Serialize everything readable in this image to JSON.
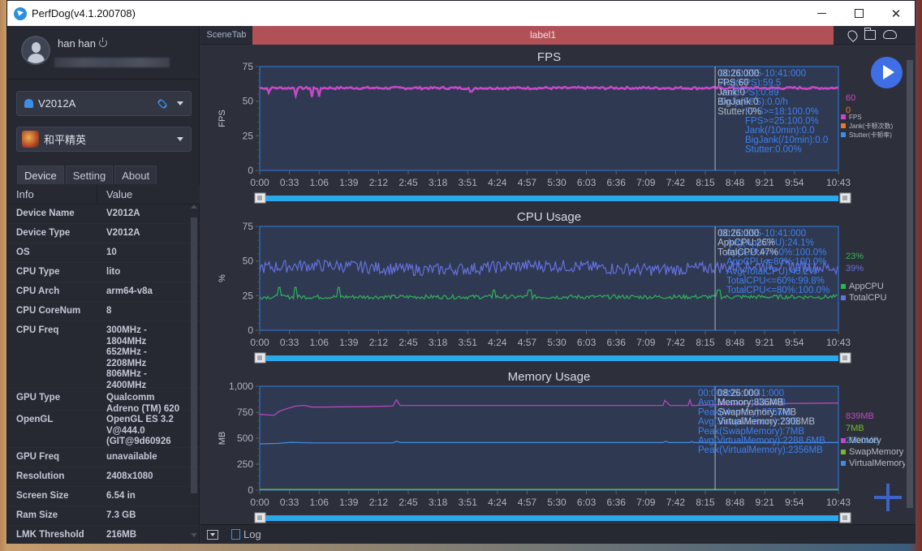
{
  "window": {
    "title": "PerfDog(v4.1.200708)"
  },
  "user": {
    "name": "han han"
  },
  "device_select": {
    "value": "V2012A"
  },
  "app_select": {
    "value": "和平精英"
  },
  "sidebar_tabs": [
    {
      "label": "Device",
      "active": true
    },
    {
      "label": "Setting",
      "active": false
    },
    {
      "label": "About",
      "active": false
    }
  ],
  "info_table": {
    "headers": [
      "Info",
      "Value"
    ],
    "rows": [
      {
        "key": "Device Name",
        "value": "V2012A"
      },
      {
        "key": "Device Type",
        "value": "V2012A"
      },
      {
        "key": "OS",
        "value": "10"
      },
      {
        "key": "CPU Type",
        "value": "lito"
      },
      {
        "key": "CPU Arch",
        "value": "arm64-v8a"
      },
      {
        "key": "CPU CoreNum",
        "value": "8"
      },
      {
        "key": "CPU Freq",
        "value": "300MHz -\n1804MHz\n652MHz -\n2208MHz\n806MHz -\n2400MHz"
      },
      {
        "key": "GPU Type",
        "value": "Qualcomm\nAdreno (TM) 620"
      },
      {
        "key": "OpenGL",
        "value": "OpenGL ES 3.2\nV@444.0\n(GIT@9d60926"
      },
      {
        "key": "GPU Freq",
        "value": "unavailable"
      },
      {
        "key": "Resolution",
        "value": "2408x1080"
      },
      {
        "key": "Screen Size",
        "value": "6.54 in"
      },
      {
        "key": "Ram Size",
        "value": "7.3 GB"
      },
      {
        "key": "LMK Threshold",
        "value": "216MB"
      }
    ]
  },
  "scene": {
    "tab_label": "SceneTab",
    "label": "label1"
  },
  "bottombar": {
    "log_label": "Log"
  },
  "colors": {
    "fps": "#c848c8",
    "jank": "#e8782a",
    "stutter": "#3e8ee8",
    "app_cpu": "#2fb35a",
    "total_cpu": "#6670e0",
    "memory": "#c048c0",
    "swap_memory": "#7ab82a",
    "virtual_memory": "#3e8ee8",
    "scene_label_bg": "#b25058",
    "play_button": "#3e6fe6"
  },
  "chart_data": [
    {
      "type": "line",
      "title": "FPS",
      "ylabel": "FPS",
      "ylim": [
        0,
        75
      ],
      "yticks": [
        "0",
        "25",
        "50",
        "75"
      ],
      "xticks": [
        "0:00",
        "0:33",
        "1:06",
        "1:39",
        "2:12",
        "2:45",
        "3:18",
        "3:51",
        "4:24",
        "4:57",
        "5:30",
        "6:03",
        "6:36",
        "7:09",
        "7:42",
        "8:15",
        "8:48",
        "9:21",
        "9:54",
        "10:43"
      ],
      "xlim_seconds": [
        0,
        643
      ],
      "cursor_time": "8:26",
      "series": [
        {
          "name": "FPS",
          "color": "#c848c8",
          "current": "60",
          "baseline": 59.5,
          "dips": [
            [
              10,
              56
            ],
            [
              40,
              54
            ],
            [
              58,
              53
            ],
            [
              66,
              54
            ],
            [
              235,
              57
            ]
          ]
        }
      ],
      "legend": [
        "FPS",
        "Jank(卡顿次数)",
        "Stutter(卡顿率)"
      ],
      "legend_values": [
        {
          "text": "60",
          "color": "#c848c8"
        },
        {
          "text": "0",
          "color": "#e8782a"
        }
      ],
      "cursor_tooltip": [
        "08:26:000",
        "FPS:60",
        "Jank:0",
        "BigJank:0",
        "Stutter:0%"
      ],
      "range_stats": [
        "00:00:895-10:41:000",
        "Avg(FPS):59.5",
        "Var(FPS):0.89",
        "Drop(FPS):0.0/h",
        "FPS>=18:100.0%",
        "FPS>=25:100.0%",
        "Jank(/10min):0.0",
        "BigJank(/10min):0.0",
        "Stutter:0.00%"
      ]
    },
    {
      "type": "line",
      "title": "CPU Usage",
      "ylabel": "%",
      "ylim": [
        0,
        75
      ],
      "yticks": [
        "0",
        "25",
        "50",
        "75"
      ],
      "xticks": [
        "0:00",
        "0:33",
        "1:06",
        "1:39",
        "2:12",
        "2:45",
        "3:18",
        "3:51",
        "4:24",
        "4:57",
        "5:30",
        "6:03",
        "6:36",
        "7:09",
        "7:42",
        "8:15",
        "8:48",
        "9:21",
        "9:54",
        "10:43"
      ],
      "xlim_seconds": [
        0,
        643
      ],
      "cursor_time": "8:26",
      "series": [
        {
          "name": "AppCPU",
          "color": "#2fb35a",
          "current": "23%",
          "baseline": 24.1,
          "spikes": [
            [
              22,
              31
            ],
            [
              40,
              31
            ],
            [
              88,
              31
            ],
            [
              260,
              29
            ],
            [
              300,
              29
            ],
            [
              510,
              29
            ]
          ]
        },
        {
          "name": "TotalCPU",
          "color": "#6670e0",
          "current": "39%",
          "baseline": 45.2
        }
      ],
      "legend": [
        "AppCPU",
        "TotalCPU"
      ],
      "cursor_tooltip": [
        "08:26:000",
        "AppCPU:26%",
        "TotalCPU:47%"
      ],
      "range_stats": [
        "00:00:895-10:41:000",
        "Avg(AppCPU):24.1%",
        "AppCPU<=60%:100.0%",
        "AppCPU<=80%:100.0%",
        "Avg(TotalCPU):45.2%",
        "TotalCPU<=60%:99.8%",
        "TotalCPU<=80%:100.0%"
      ]
    },
    {
      "type": "line",
      "title": "Memory Usage",
      "ylabel": "MB",
      "ylim": [
        0,
        1000
      ],
      "yticks": [
        "0",
        "250",
        "500",
        "750",
        "1,000"
      ],
      "xticks": [
        "0:00",
        "0:33",
        "1:06",
        "1:39",
        "2:12",
        "2:45",
        "3:18",
        "3:51",
        "4:24",
        "4:57",
        "5:30",
        "6:03",
        "6:36",
        "7:09",
        "7:42",
        "8:15",
        "8:48",
        "9:21",
        "9:54",
        "10:43"
      ],
      "xlim_seconds": [
        0,
        643
      ],
      "cursor_time": "8:26",
      "series": [
        {
          "name": "Memory",
          "color": "#c048c0",
          "current": "839MB",
          "points": [
            [
              0,
              730
            ],
            [
              8,
              725
            ],
            [
              16,
              720
            ],
            [
              22,
              760
            ],
            [
              32,
              790
            ],
            [
              40,
              810
            ],
            [
              50,
              815
            ],
            [
              58,
              800
            ],
            [
              70,
              800
            ],
            [
              120,
              805
            ],
            [
              148,
              810
            ],
            [
              152,
              870
            ],
            [
              156,
              815
            ],
            [
              300,
              815
            ],
            [
              420,
              815
            ],
            [
              448,
              815
            ],
            [
              450,
              865
            ],
            [
              456,
              815
            ],
            [
              476,
              815
            ],
            [
              478,
              870
            ],
            [
              480,
              815
            ],
            [
              530,
              830
            ],
            [
              600,
              835
            ],
            [
              643,
              839
            ]
          ]
        },
        {
          "name": "SwapMemory",
          "color": "#7ab82a",
          "current": "7MB",
          "points": [
            [
              0,
              7
            ],
            [
              643,
              7
            ]
          ]
        },
        {
          "name": "VirtualMemory",
          "color": "#3e8ee8",
          "current": "2300MB",
          "points": [
            [
              0,
              445
            ],
            [
              20,
              450
            ],
            [
              35,
              460
            ],
            [
              60,
              455
            ],
            [
              148,
              455
            ],
            [
              152,
              470
            ],
            [
              156,
              458
            ],
            [
              448,
              458
            ],
            [
              451,
              470
            ],
            [
              455,
              458
            ],
            [
              478,
              458
            ],
            [
              480,
              468
            ],
            [
              482,
              458
            ],
            [
              643,
              458
            ]
          ]
        }
      ],
      "legend": [
        "Memory",
        "SwapMemory",
        "VirtualMemory"
      ],
      "cursor_tooltip": [
        "08:26:000",
        "Memory:836MB",
        "SwapMemory:7MB",
        "VirtualMemory:2308MB"
      ],
      "range_stats": [
        "00:00:895-10:41:000",
        "Avg(Memory):813MB",
        "Peak(Memory):875MB",
        "Avg(SwapMemory):7MB",
        "Peak(SwapMemory):7MB",
        "Avg(VirtualMemory):2288.6MB",
        "Peak(VirtualMemory):2356MB"
      ]
    }
  ]
}
